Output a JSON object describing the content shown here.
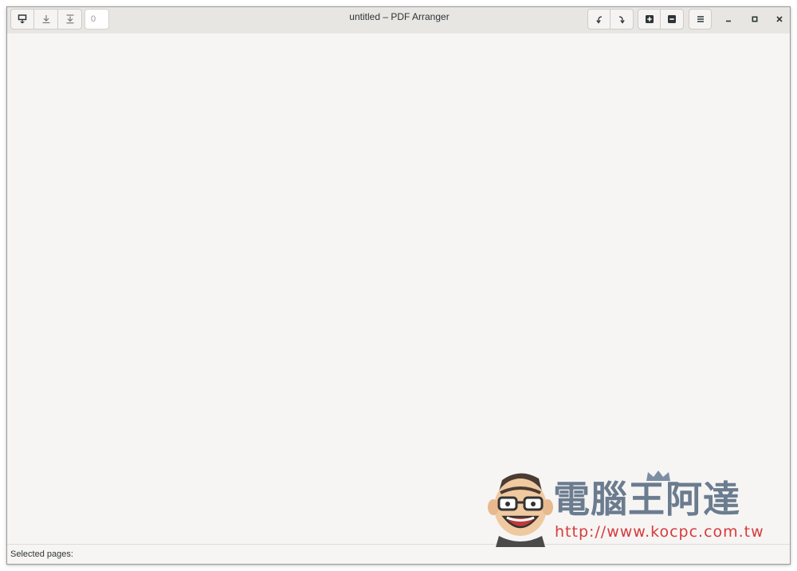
{
  "window": {
    "title": "untitled – PDF Arranger"
  },
  "toolbar": {
    "import_icon": "import-icon",
    "save_icon": "save-icon",
    "save_as_icon": "save-as-icon",
    "zoom_value": "0",
    "rotate_left_icon": "rotate-left-icon",
    "rotate_right_icon": "rotate-right-icon",
    "zoom_in_icon": "zoom-in-icon",
    "zoom_out_icon": "zoom-out-icon",
    "menu_icon": "hamburger-menu-icon"
  },
  "window_controls": [
    "minimize-icon",
    "maximize-icon",
    "close-icon"
  ],
  "statusbar": {
    "label": "Selected pages:"
  },
  "watermark": {
    "title": "電腦王阿達",
    "url": "http://www.kocpc.com.tw"
  },
  "colors": {
    "headerbar": "#e8e6e3",
    "background": "#f6f5f4",
    "watermark_text": "#6b7c8f",
    "watermark_url": "#d63b3b"
  }
}
